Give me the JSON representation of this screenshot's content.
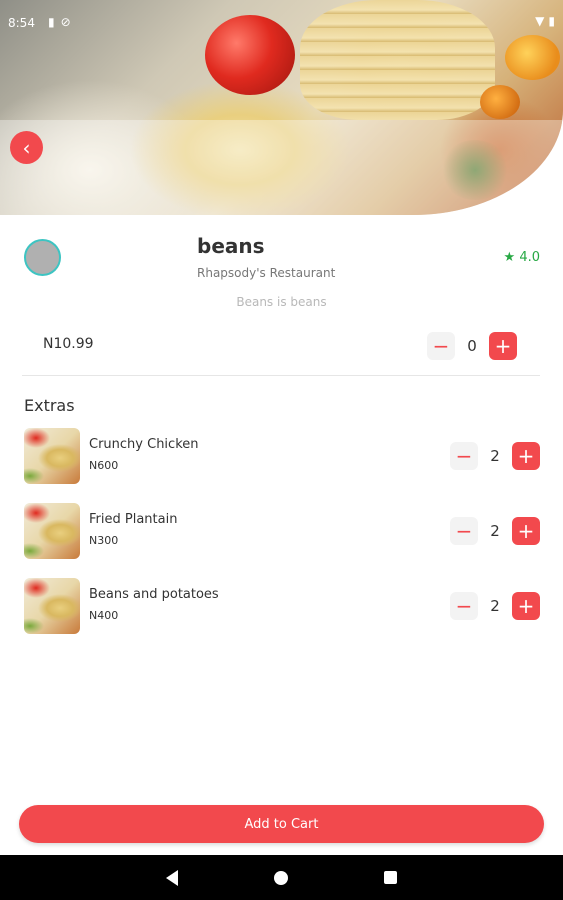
{
  "status_bar": {
    "time": "8:54",
    "left_icons": [
      "sd-card-icon",
      "no-sim-icon"
    ],
    "right_icons": [
      "wifi-icon",
      "battery-icon"
    ]
  },
  "item": {
    "name": "beans",
    "restaurant": "Rhapsody's Restaurant",
    "rating": "★ 4.0",
    "description": "Beans is beans",
    "price": "N10.99",
    "quantity": "0"
  },
  "controls": {
    "minus": "−",
    "plus": "+",
    "back": "‹"
  },
  "extras": {
    "title": "Extras",
    "items": [
      {
        "name": "Crunchy Chicken",
        "price": "N600",
        "quantity": "2"
      },
      {
        "name": "Fried Plantain",
        "price": "N300",
        "quantity": "2"
      },
      {
        "name": "Beans and potatoes",
        "price": "N400",
        "quantity": "2"
      }
    ]
  },
  "add_to_cart": {
    "label": "Add to Cart"
  },
  "colors": {
    "accent": "#f2494d",
    "rating": "#27a844",
    "avatar_ring": "#3dc4c2"
  }
}
